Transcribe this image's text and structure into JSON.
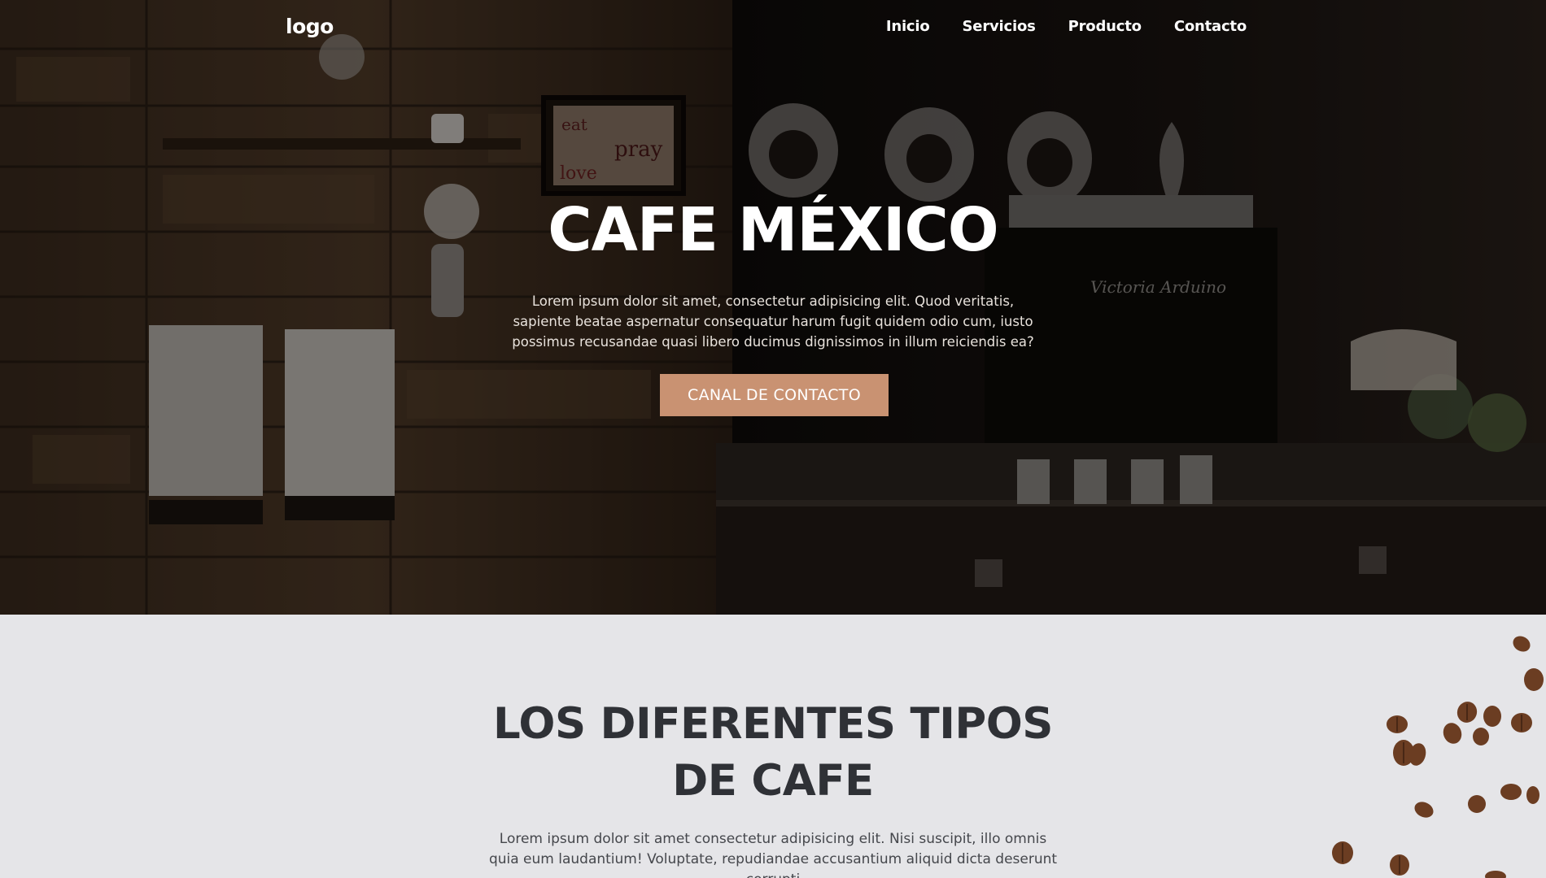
{
  "nav": {
    "logo": "logo",
    "links": [
      "Inicio",
      "Servicios",
      "Producto",
      "Contacto"
    ]
  },
  "hero": {
    "title": "CAFE MÉXICO",
    "text": "Lorem ipsum dolor sit amet, consectetur adipisicing elit. Quod veritatis, sapiente beatae aspernatur consequatur harum fugit quidem odio cum, iusto possimus recusandae quasi libero ducimus dignissimos in illum reiciendis ea?",
    "cta_label": "CANAL DE CONTACTO",
    "sign_text": "eat pray love",
    "machine_brand": "Victoria Arduino"
  },
  "types": {
    "title": "LOS DIFERENTES TIPOS DE CAFE",
    "text": "Lorem ipsum dolor sit amet consectetur adipisicing elit. Nisi suscipit, illo omnis quia eum laudantium! Voluptate, repudiandae accusantium aliquid dicta deserunt corrupti"
  },
  "colors": {
    "accent": "#c99272",
    "heading_dark": "#2f3136",
    "section_bg": "#e5e5e8"
  }
}
